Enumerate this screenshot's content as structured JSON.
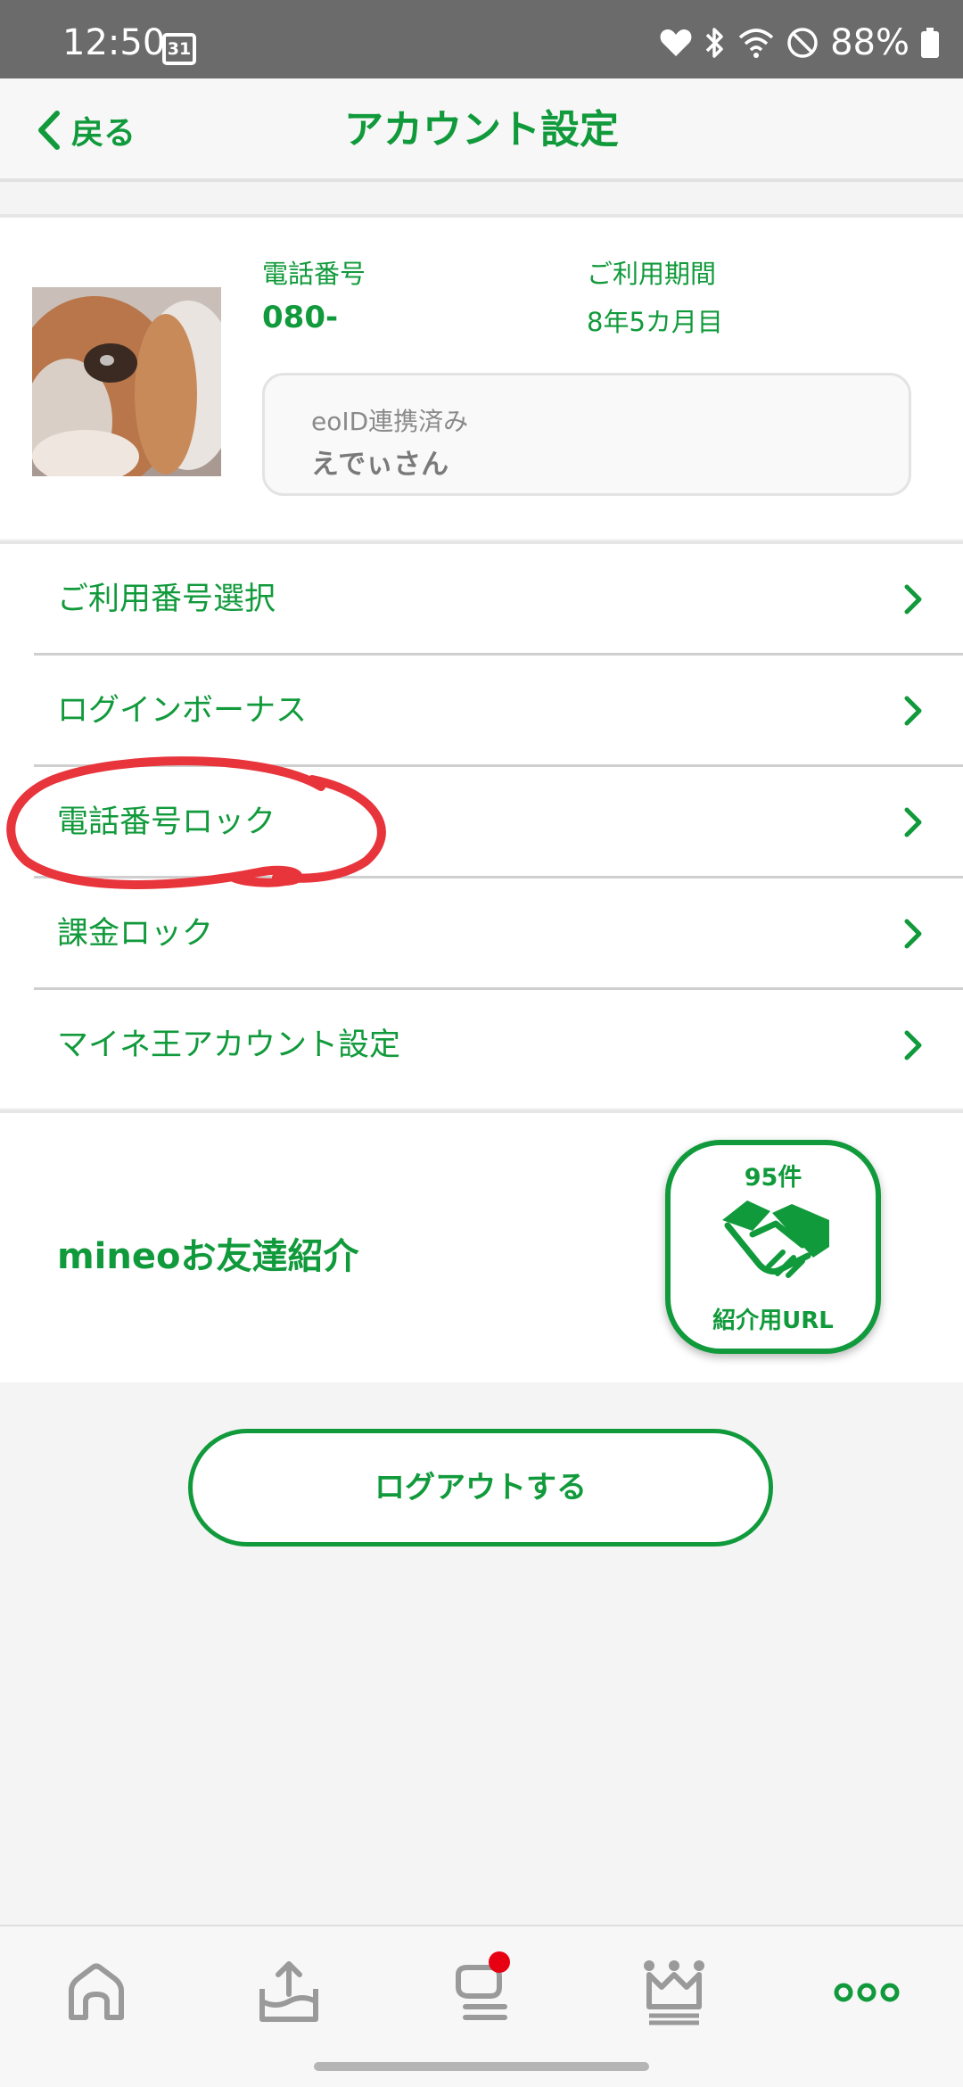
{
  "status_bar": {
    "time": "12:50",
    "calendar_day": "31",
    "battery": "88%"
  },
  "header": {
    "back_label": "戻る",
    "title": "アカウント設定"
  },
  "profile": {
    "phone_label": "電話番号",
    "phone_number": "080-",
    "term_label": "ご利用期間",
    "term_value": "8年5カ月目",
    "eoid_status": "eoID連携済み",
    "eoid_name": "えでぃさん"
  },
  "menu": {
    "items": [
      {
        "label": "ご利用番号選択"
      },
      {
        "label": "ログインボーナス"
      },
      {
        "label": "電話番号ロック"
      },
      {
        "label": "課金ロック"
      },
      {
        "label": "マイネ王アカウント設定"
      }
    ]
  },
  "referral": {
    "title": "mineoお友達紹介",
    "count": "95件",
    "url_label": "紹介用URL"
  },
  "logout_label": "ログアウトする",
  "bottom_nav": {
    "items": [
      {
        "icon": "home-icon"
      },
      {
        "icon": "data-share-icon"
      },
      {
        "icon": "chat-icon",
        "badge": true
      },
      {
        "icon": "crown-icon"
      },
      {
        "icon": "more-icon",
        "active": true
      }
    ]
  },
  "colors": {
    "accent": "#119a3b",
    "badge": "#e60012",
    "annotation": "#e8343b"
  }
}
